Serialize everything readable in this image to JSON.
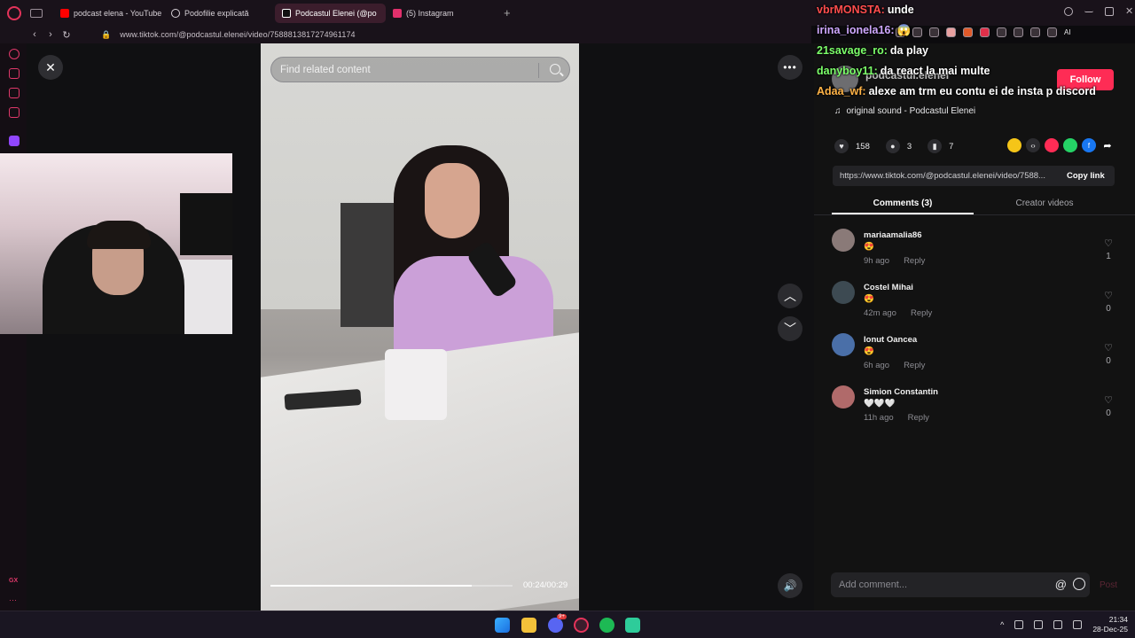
{
  "browser": {
    "tabs": [
      {
        "label": "podcast elena - YouTube",
        "favicon": "youtube-icon",
        "color": "#ff0000",
        "active": false
      },
      {
        "label": "Podofilie explicată",
        "favicon": "chatgpt-icon",
        "color": "#d8d2d8",
        "active": false
      },
      {
        "label": "Podcastul Elenei (@po",
        "favicon": "tiktok-icon",
        "color": "#ffffff",
        "active": true
      },
      {
        "label": "(5) Instagram",
        "favicon": "instagram-icon",
        "color": "#e1306c",
        "active": false
      }
    ],
    "new_tab": "+",
    "url": "www.tiktok.com/@podcastul.elenei/video/7588813817274961174",
    "extension_label": "AI"
  },
  "video": {
    "search_placeholder": "Find related content",
    "time": "00:24/00:29",
    "progress_fraction": 0.83
  },
  "chat": [
    {
      "user": "vbrMONSTA:",
      "message": "unde",
      "color": "#ff4d4d"
    },
    {
      "user": "irina_ionela16:",
      "message": "😱",
      "color": "#cfa8ff"
    },
    {
      "user": "21savage_ro:",
      "message": "da play",
      "color": "#7cff6a"
    },
    {
      "user": "danyboy11:",
      "message": "da react la mai multe",
      "color": "#7cff6a"
    },
    {
      "user": "Adaa_wf:",
      "message": "alexe am trm eu contu ei de insta p discord",
      "color": "#ffb347"
    }
  ],
  "creator": {
    "name": "podcastul.elenei",
    "follow_label": "Follow",
    "sound": "original sound - Podcastul Elenei"
  },
  "stats": {
    "likes": "158",
    "comments": "3",
    "saves": "7"
  },
  "share": {
    "link": "https://www.tiktok.com/@podcastul.elenei/video/7588...",
    "copy_label": "Copy link"
  },
  "panel_tabs": {
    "comments": "Comments (3)",
    "creator_videos": "Creator videos"
  },
  "comments": [
    {
      "name": "mariaamalia86",
      "text": "😍",
      "time": "9h ago",
      "reply": "Reply",
      "likes": "1",
      "avatar_color": "#8a7a78"
    },
    {
      "name": "Costel Mihai",
      "text": "😍",
      "time": "42m ago",
      "reply": "Reply",
      "likes": "0",
      "avatar_color": "#3d4a52"
    },
    {
      "name": "Ionut Oancea",
      "text": "😍",
      "time": "6h ago",
      "reply": "Reply",
      "likes": "0",
      "avatar_color": "#4a6fa8"
    },
    {
      "name": "Simion Constantin",
      "text": "🤍🤍🤍",
      "time": "11h ago",
      "reply": "Reply",
      "likes": "0",
      "avatar_color": "#b06a6a"
    }
  ],
  "comment_input": {
    "placeholder": "Add comment...",
    "at": "@",
    "post_label": "Post"
  },
  "sidebar_bottom": {
    "gx_label": "GX",
    "more_label": "···"
  },
  "taskbar": {
    "time": "21:34",
    "date": "28-Dec-25",
    "discord_badge": "9+"
  }
}
